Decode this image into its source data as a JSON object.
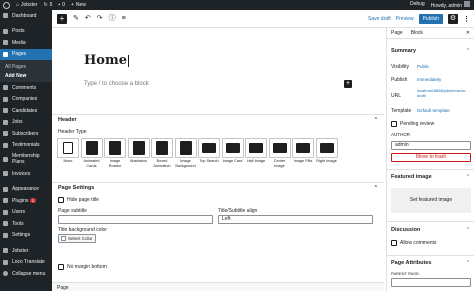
{
  "adminbar": {
    "site_name": "Jobster",
    "updates": "5",
    "comments": "0",
    "new_label": "New",
    "debug": "Debug",
    "howdy": "Howdy, admin"
  },
  "sidebar": {
    "items": [
      {
        "label": "Dashboard"
      },
      {
        "label": "Posts"
      },
      {
        "label": "Media"
      },
      {
        "label": "Pages"
      },
      {
        "label": "All Pages"
      },
      {
        "label": "Add New"
      },
      {
        "label": "Comments"
      },
      {
        "label": "Companies"
      },
      {
        "label": "Candidates"
      },
      {
        "label": "Jobs"
      },
      {
        "label": "Subscribers"
      },
      {
        "label": "Testimonials"
      },
      {
        "label": "Membership Plans"
      },
      {
        "label": "Invoices"
      },
      {
        "label": "Appearance"
      },
      {
        "label": "Plugins",
        "badge": "1"
      },
      {
        "label": "Users"
      },
      {
        "label": "Tools"
      },
      {
        "label": "Settings"
      },
      {
        "label": "Jobster"
      },
      {
        "label": "Loco Translate"
      },
      {
        "label": "Collapse menu"
      }
    ]
  },
  "toolbar": {
    "save_draft": "Save draft",
    "preview": "Preview",
    "publish": "Publish"
  },
  "editor": {
    "title": "Home",
    "placeholder": "Type / to choose a block"
  },
  "header_section": {
    "title": "Header",
    "type_label": "Header Type",
    "types": [
      {
        "label": "None"
      },
      {
        "label": "Animated Cards"
      },
      {
        "label": "Image Rotator"
      },
      {
        "label": "Illustration"
      },
      {
        "label": "Boxed Animation"
      },
      {
        "label": "Image Background"
      },
      {
        "label": "Top Search"
      },
      {
        "label": "Image Card"
      },
      {
        "label": "Half Image"
      },
      {
        "label": "Center Image"
      },
      {
        "label": "Image Pills"
      },
      {
        "label": "Right Image"
      }
    ]
  },
  "page_settings": {
    "title": "Page Settings",
    "hide_title": "Hide page title",
    "subtitle_label": "Page subtitle",
    "align_label": "Title/Subtitle align",
    "align_value": "Left",
    "bg_color_label": "Title background color",
    "select_color": "Select Color",
    "no_margin": "No margin bottom"
  },
  "footer": {
    "tag": "Page"
  },
  "settings_panel": {
    "tab_page": "Page",
    "tab_block": "Block",
    "summary": "Summary",
    "visibility_label": "Visibility",
    "visibility_value": "Public",
    "publish_label": "Publish",
    "publish_value": "Immediately",
    "url_label": "URL",
    "url_value": "localhost:8888/jobster/auto-draft/",
    "template_label": "Template",
    "template_value": "Default template",
    "pending_review": "Pending review",
    "author_label": "AUTHOR",
    "author_value": "admin",
    "trash": "Move to trash",
    "featured_image": "Featured image",
    "set_featured": "Set featured image",
    "discussion": "Discussion",
    "allow_comments": "Allow comments",
    "page_attributes": "Page Attributes",
    "parent_page": "PARENT PAGE:"
  }
}
